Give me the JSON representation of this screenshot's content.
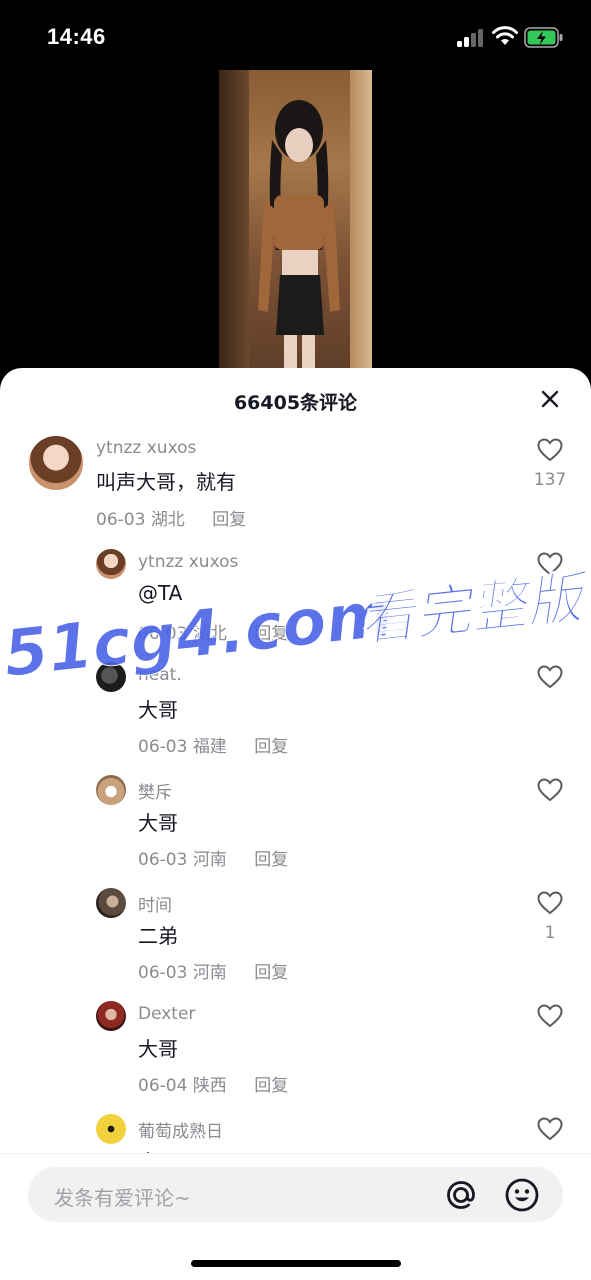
{
  "status": {
    "time": "14:46",
    "battery_color": "#34c759"
  },
  "video": {
    "description_icon": "video-thumbnail"
  },
  "comments_panel": {
    "title": "66405条评论",
    "close_icon": "close-icon"
  },
  "comments": [
    {
      "name": "ytnzz xuxos",
      "text": "叫声大哥，就有",
      "date": "06-03",
      "location": "湖北",
      "reply": "回复",
      "likes": "137",
      "avatar_color": "#c9926a"
    },
    {
      "name": "ytnzz xuxos",
      "text": "@TA",
      "date": "06-03",
      "location": "湖北",
      "reply": "回复",
      "likes": "",
      "avatar_color": "#c9926a"
    },
    {
      "name": "neat.",
      "text": "大哥",
      "date": "06-03",
      "location": "福建",
      "reply": "回复",
      "likes": "",
      "avatar_color": "#2b2b2b"
    },
    {
      "name": "樊斥",
      "text": "大哥",
      "date": "06-03",
      "location": "河南",
      "reply": "回复",
      "likes": "",
      "avatar_color": "#c7a27c"
    },
    {
      "name": "时间",
      "text": "二弟",
      "date": "06-03",
      "location": "河南",
      "reply": "回复",
      "likes": "1",
      "avatar_color": "#5a4a3f"
    },
    {
      "name": "Dexter",
      "text": "大哥",
      "date": "06-04",
      "location": "陕西",
      "reply": "回复",
      "likes": "",
      "avatar_color": "#8e2a22"
    },
    {
      "name": "葡萄成熟日",
      "text": "大哥",
      "date": "",
      "location": "",
      "reply": "",
      "likes": "",
      "avatar_color": "#f2d23c"
    }
  ],
  "watermark": {
    "text_a": "51cg4.com",
    "text_b": "看完整版",
    "color": "#4b63e6"
  },
  "input": {
    "placeholder": "发条有爱评论~",
    "at_icon": "at-icon",
    "emoji_icon": "emoji-icon"
  }
}
